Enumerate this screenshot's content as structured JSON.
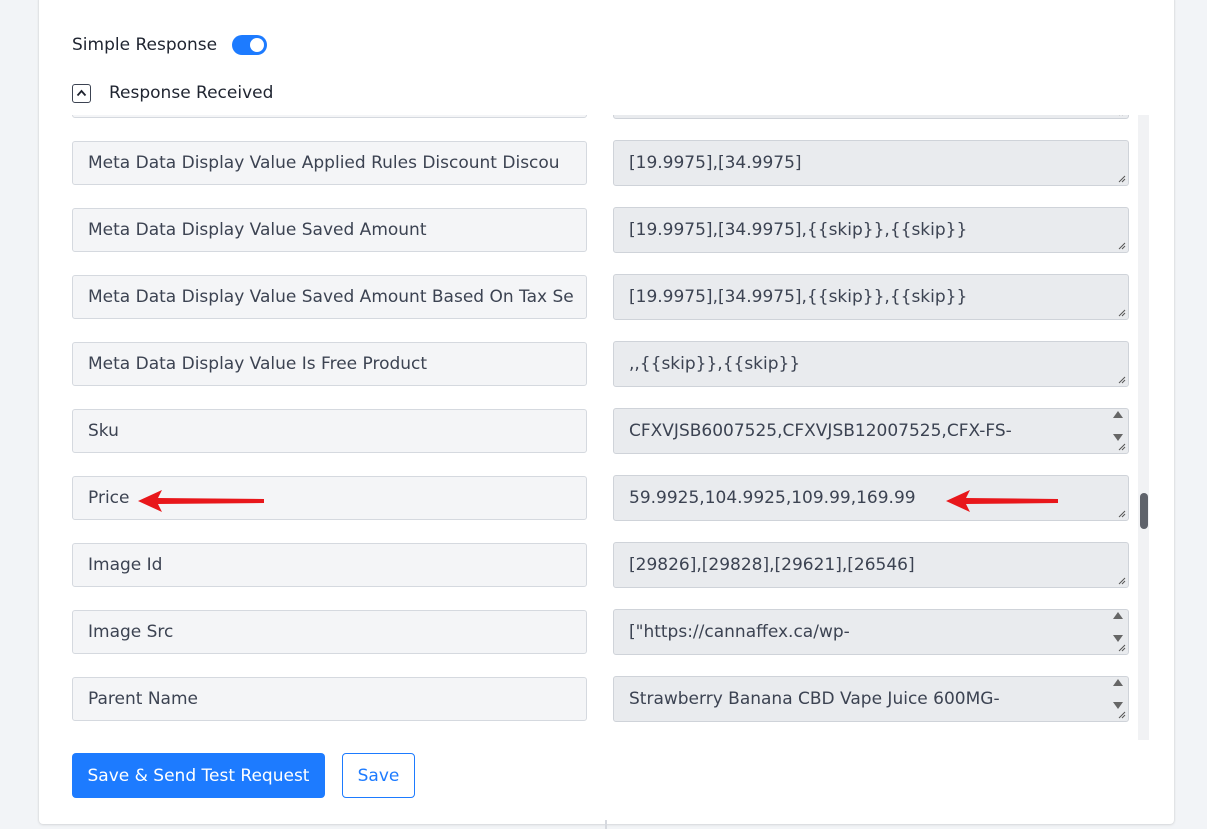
{
  "simple_response": {
    "label": "Simple Response",
    "enabled": true
  },
  "response_received": {
    "label": "Response Received",
    "expanded": true
  },
  "rows": [
    {
      "key": "",
      "value": ""
    },
    {
      "key": "Meta Data Display Value Applied Rules  Discount Discou",
      "value": "[19.9975],[34.9975]"
    },
    {
      "key": "Meta Data Display Value Saved Amount",
      "value": "[19.9975],[34.9975],{{skip}},{{skip}}"
    },
    {
      "key": "Meta Data Display Value Saved Amount Based On Tax Se",
      "value": "[19.9975],[34.9975],{{skip}},{{skip}}"
    },
    {
      "key": "Meta Data Display Value Is Free Product",
      "value": ",,{{skip}},{{skip}}"
    },
    {
      "key": "Sku",
      "value": "CFXVJSB6007525,CFXVJSB12007525,CFX-FS-"
    },
    {
      "key": "Price",
      "value": "59.9925,104.9925,109.99,169.99"
    },
    {
      "key": "Image Id",
      "value": "[29826],[29828],[29621],[26546]"
    },
    {
      "key": "Image Src",
      "value": "[\"https://cannaffex.ca/wp-"
    },
    {
      "key": "Parent Name",
      "value": "Strawberry Banana CBD Vape Juice 600MG-"
    }
  ],
  "buttons": {
    "save_send": "Save & Send Test Request",
    "save": "Save"
  },
  "colors": {
    "accent": "#1d7bff",
    "arrow": "#e8171b"
  },
  "icons": {
    "collapse": "chevron-up-icon",
    "resize": "resize-grip-icon",
    "spinner": "spinner-arrows-icon",
    "annotation": "red-arrow-icon"
  }
}
